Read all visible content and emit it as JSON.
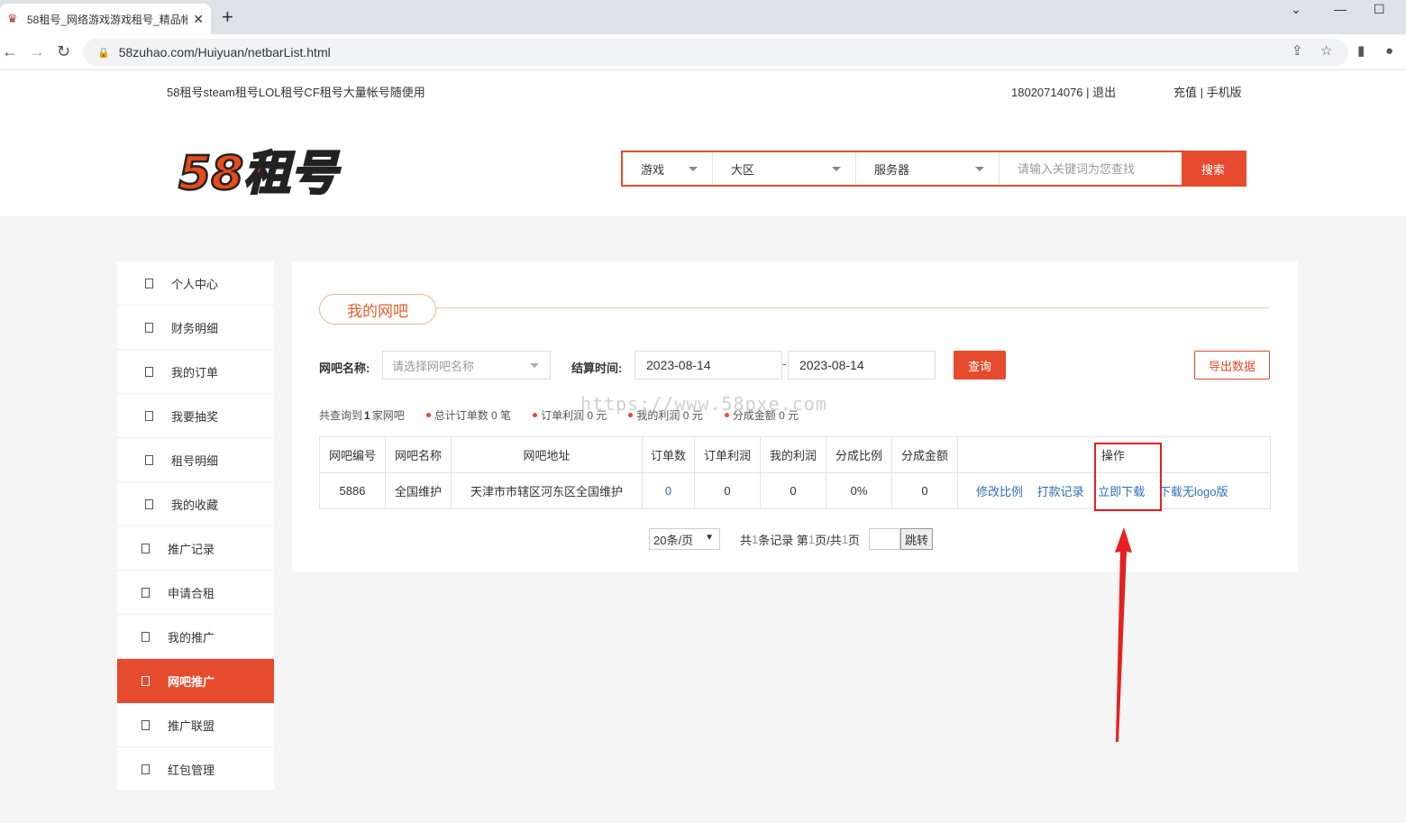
{
  "browser": {
    "tab_title": "58租号_网络游戏游戏租号_精品帐",
    "url": "58zuhao.com/Huiyuan/netbarList.html"
  },
  "site": {
    "slogan": "58租号steam租号LOL租号CF租号大量帐号随便用",
    "user_info": "18020714076 | 退出",
    "top_links": "充值 | 手机版",
    "logo_text": "58租号"
  },
  "search": {
    "game": "游戏",
    "region": "大区",
    "server": "服务器",
    "placeholder": "请输入关键词为您查找",
    "button": "搜索"
  },
  "sidebar": {
    "items": [
      {
        "label": "个人中心"
      },
      {
        "label": "财务明细"
      },
      {
        "label": "我的订单"
      },
      {
        "label": "我要抽奖"
      },
      {
        "label": "租号明细"
      },
      {
        "label": "我的收藏"
      },
      {
        "label": "推广记录"
      },
      {
        "label": "申请合租"
      },
      {
        "label": "我的推广"
      },
      {
        "label": "网吧推广"
      },
      {
        "label": "推广联盟"
      },
      {
        "label": "红包管理"
      }
    ],
    "active": "网吧推广"
  },
  "main": {
    "title": "我的网吧",
    "filter": {
      "netbar_label": "网吧名称:",
      "netbar_placeholder": "请选择网吧名称",
      "time_label": "结算时间:",
      "date_from": "2023-08-14",
      "date_to": "2023-08-14",
      "separator": "-",
      "query_button": "查询",
      "export_button": "导出数据"
    },
    "summary": {
      "prefix": "共查询到",
      "count": "1",
      "suffix": "家网吧",
      "stats": [
        "总计订单数 0 笔",
        "订单利润 0 元",
        "我的利润 0 元",
        "分成金额 0 元"
      ]
    },
    "watermark": "https://www.58pxe.com",
    "table": {
      "headers": [
        "网吧编号",
        "网吧名称",
        "网吧地址",
        "订单数",
        "订单利润",
        "我的利润",
        "分成比例",
        "分成金额",
        "操作"
      ],
      "rows": [
        {
          "id": "5886",
          "name": "全国维护",
          "address": "天津市市辖区河东区全国维护",
          "orders": "0",
          "order_profit": "0",
          "my_profit": "0",
          "ratio": "0%",
          "amount": "0",
          "actions": [
            "修改比例",
            "打款记录",
            "立即下载",
            "下载无logo版"
          ]
        }
      ]
    },
    "pager": {
      "page_size": "20条/页",
      "total_prefix": "共",
      "total": "1",
      "total_suffix": "条记录 第",
      "page": "1",
      "page_mid": "页/共",
      "pages": "1",
      "page_suffix": "页",
      "jump_button": "跳转"
    }
  },
  "colors": {
    "accent": "#e64b2e",
    "link": "#2f6fbd",
    "annotation": "#e52020"
  }
}
